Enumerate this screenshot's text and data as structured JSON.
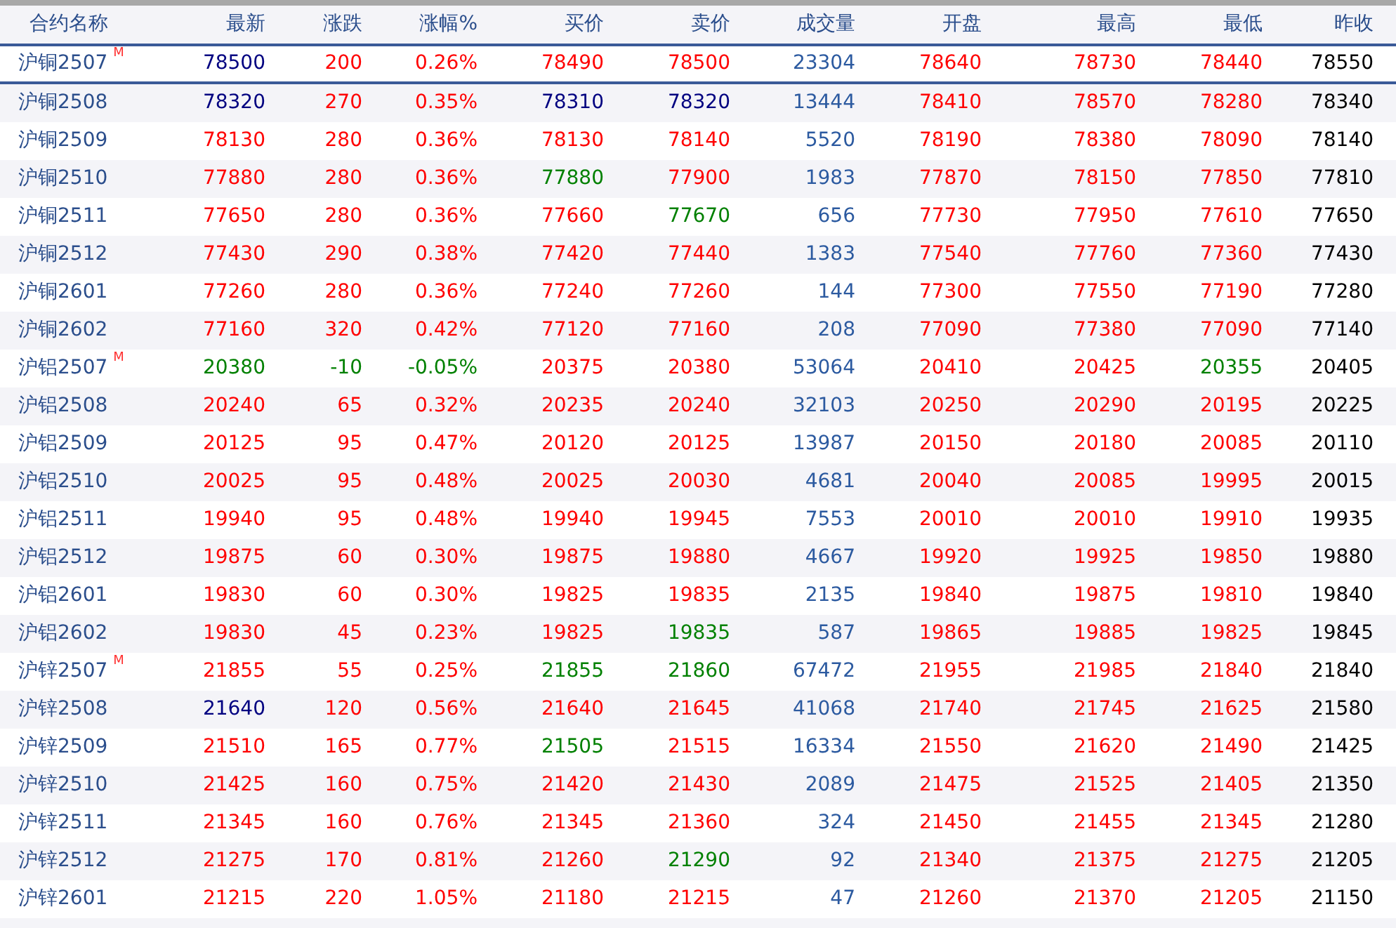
{
  "table": {
    "name_column": "合约名称",
    "columns": [
      "最新",
      "涨跌",
      "涨幅%",
      "买价",
      "卖价",
      "成交量",
      "开盘",
      "最高",
      "最低",
      "昨收"
    ],
    "rows": [
      {
        "name": "沪铜2507",
        "main_mark": "M",
        "selected": true,
        "cells": [
          {
            "text": "78500",
            "color": "#000080"
          },
          {
            "text": "200",
            "color": "#ff0000"
          },
          {
            "text": "0.26%",
            "color": "#ff0000"
          },
          {
            "text": "78490",
            "color": "#ff0000"
          },
          {
            "text": "78500",
            "color": "#ff0000"
          },
          {
            "text": "23304",
            "color": "#2c5aa0"
          },
          {
            "text": "78640",
            "color": "#ff0000"
          },
          {
            "text": "78730",
            "color": "#ff0000"
          },
          {
            "text": "78440",
            "color": "#ff0000"
          },
          {
            "text": "78550",
            "color": "#000000"
          }
        ]
      },
      {
        "name": "沪铜2508",
        "selected": false,
        "cells": [
          {
            "text": "78320",
            "color": "#000080"
          },
          {
            "text": "270",
            "color": "#ff0000"
          },
          {
            "text": "0.35%",
            "color": "#ff0000"
          },
          {
            "text": "78310",
            "color": "#000080"
          },
          {
            "text": "78320",
            "color": "#000080"
          },
          {
            "text": "13444",
            "color": "#2c5aa0"
          },
          {
            "text": "78410",
            "color": "#ff0000"
          },
          {
            "text": "78570",
            "color": "#ff0000"
          },
          {
            "text": "78280",
            "color": "#ff0000"
          },
          {
            "text": "78340",
            "color": "#000000"
          }
        ]
      },
      {
        "name": "沪铜2509",
        "selected": false,
        "cells": [
          {
            "text": "78130",
            "color": "#ff0000"
          },
          {
            "text": "280",
            "color": "#ff0000"
          },
          {
            "text": "0.36%",
            "color": "#ff0000"
          },
          {
            "text": "78130",
            "color": "#ff0000"
          },
          {
            "text": "78140",
            "color": "#ff0000"
          },
          {
            "text": "5520",
            "color": "#2c5aa0"
          },
          {
            "text": "78190",
            "color": "#ff0000"
          },
          {
            "text": "78380",
            "color": "#ff0000"
          },
          {
            "text": "78090",
            "color": "#ff0000"
          },
          {
            "text": "78140",
            "color": "#000000"
          }
        ]
      },
      {
        "name": "沪铜2510",
        "selected": false,
        "cells": [
          {
            "text": "77880",
            "color": "#ff0000"
          },
          {
            "text": "280",
            "color": "#ff0000"
          },
          {
            "text": "0.36%",
            "color": "#ff0000"
          },
          {
            "text": "77880",
            "color": "#008000"
          },
          {
            "text": "77900",
            "color": "#ff0000"
          },
          {
            "text": "1983",
            "color": "#2c5aa0"
          },
          {
            "text": "77870",
            "color": "#ff0000"
          },
          {
            "text": "78150",
            "color": "#ff0000"
          },
          {
            "text": "77850",
            "color": "#ff0000"
          },
          {
            "text": "77810",
            "color": "#000000"
          }
        ]
      },
      {
        "name": "沪铜2511",
        "selected": false,
        "cells": [
          {
            "text": "77650",
            "color": "#ff0000"
          },
          {
            "text": "280",
            "color": "#ff0000"
          },
          {
            "text": "0.36%",
            "color": "#ff0000"
          },
          {
            "text": "77660",
            "color": "#ff0000"
          },
          {
            "text": "77670",
            "color": "#008000"
          },
          {
            "text": "656",
            "color": "#2c5aa0"
          },
          {
            "text": "77730",
            "color": "#ff0000"
          },
          {
            "text": "77950",
            "color": "#ff0000"
          },
          {
            "text": "77610",
            "color": "#ff0000"
          },
          {
            "text": "77650",
            "color": "#000000"
          }
        ]
      },
      {
        "name": "沪铜2512",
        "selected": false,
        "cells": [
          {
            "text": "77430",
            "color": "#ff0000"
          },
          {
            "text": "290",
            "color": "#ff0000"
          },
          {
            "text": "0.38%",
            "color": "#ff0000"
          },
          {
            "text": "77420",
            "color": "#ff0000"
          },
          {
            "text": "77440",
            "color": "#ff0000"
          },
          {
            "text": "1383",
            "color": "#2c5aa0"
          },
          {
            "text": "77540",
            "color": "#ff0000"
          },
          {
            "text": "77760",
            "color": "#ff0000"
          },
          {
            "text": "77360",
            "color": "#ff0000"
          },
          {
            "text": "77430",
            "color": "#000000"
          }
        ]
      },
      {
        "name": "沪铜2601",
        "selected": false,
        "cells": [
          {
            "text": "77260",
            "color": "#ff0000"
          },
          {
            "text": "280",
            "color": "#ff0000"
          },
          {
            "text": "0.36%",
            "color": "#ff0000"
          },
          {
            "text": "77240",
            "color": "#ff0000"
          },
          {
            "text": "77260",
            "color": "#ff0000"
          },
          {
            "text": "144",
            "color": "#2c5aa0"
          },
          {
            "text": "77300",
            "color": "#ff0000"
          },
          {
            "text": "77550",
            "color": "#ff0000"
          },
          {
            "text": "77190",
            "color": "#ff0000"
          },
          {
            "text": "77280",
            "color": "#000000"
          }
        ]
      },
      {
        "name": "沪铜2602",
        "selected": false,
        "cells": [
          {
            "text": "77160",
            "color": "#ff0000"
          },
          {
            "text": "320",
            "color": "#ff0000"
          },
          {
            "text": "0.42%",
            "color": "#ff0000"
          },
          {
            "text": "77120",
            "color": "#ff0000"
          },
          {
            "text": "77160",
            "color": "#ff0000"
          },
          {
            "text": "208",
            "color": "#2c5aa0"
          },
          {
            "text": "77090",
            "color": "#ff0000"
          },
          {
            "text": "77380",
            "color": "#ff0000"
          },
          {
            "text": "77090",
            "color": "#ff0000"
          },
          {
            "text": "77140",
            "color": "#000000"
          }
        ]
      },
      {
        "name": "沪铝2507",
        "main_mark": "M",
        "selected": false,
        "cells": [
          {
            "text": "20380",
            "color": "#008000"
          },
          {
            "text": "-10",
            "color": "#008000"
          },
          {
            "text": "-0.05%",
            "color": "#008000"
          },
          {
            "text": "20375",
            "color": "#ff0000"
          },
          {
            "text": "20380",
            "color": "#ff0000"
          },
          {
            "text": "53064",
            "color": "#2c5aa0"
          },
          {
            "text": "20410",
            "color": "#ff0000"
          },
          {
            "text": "20425",
            "color": "#ff0000"
          },
          {
            "text": "20355",
            "color": "#008000"
          },
          {
            "text": "20405",
            "color": "#000000"
          }
        ]
      },
      {
        "name": "沪铝2508",
        "selected": false,
        "cells": [
          {
            "text": "20240",
            "color": "#ff0000"
          },
          {
            "text": "65",
            "color": "#ff0000"
          },
          {
            "text": "0.32%",
            "color": "#ff0000"
          },
          {
            "text": "20235",
            "color": "#ff0000"
          },
          {
            "text": "20240",
            "color": "#ff0000"
          },
          {
            "text": "32103",
            "color": "#2c5aa0"
          },
          {
            "text": "20250",
            "color": "#ff0000"
          },
          {
            "text": "20290",
            "color": "#ff0000"
          },
          {
            "text": "20195",
            "color": "#ff0000"
          },
          {
            "text": "20225",
            "color": "#000000"
          }
        ]
      },
      {
        "name": "沪铝2509",
        "selected": false,
        "cells": [
          {
            "text": "20125",
            "color": "#ff0000"
          },
          {
            "text": "95",
            "color": "#ff0000"
          },
          {
            "text": "0.47%",
            "color": "#ff0000"
          },
          {
            "text": "20120",
            "color": "#ff0000"
          },
          {
            "text": "20125",
            "color": "#ff0000"
          },
          {
            "text": "13987",
            "color": "#2c5aa0"
          },
          {
            "text": "20150",
            "color": "#ff0000"
          },
          {
            "text": "20180",
            "color": "#ff0000"
          },
          {
            "text": "20085",
            "color": "#ff0000"
          },
          {
            "text": "20110",
            "color": "#000000"
          }
        ]
      },
      {
        "name": "沪铝2510",
        "selected": false,
        "cells": [
          {
            "text": "20025",
            "color": "#ff0000"
          },
          {
            "text": "95",
            "color": "#ff0000"
          },
          {
            "text": "0.48%",
            "color": "#ff0000"
          },
          {
            "text": "20025",
            "color": "#ff0000"
          },
          {
            "text": "20030",
            "color": "#ff0000"
          },
          {
            "text": "4681",
            "color": "#2c5aa0"
          },
          {
            "text": "20040",
            "color": "#ff0000"
          },
          {
            "text": "20085",
            "color": "#ff0000"
          },
          {
            "text": "19995",
            "color": "#ff0000"
          },
          {
            "text": "20015",
            "color": "#000000"
          }
        ]
      },
      {
        "name": "沪铝2511",
        "selected": false,
        "cells": [
          {
            "text": "19940",
            "color": "#ff0000"
          },
          {
            "text": "95",
            "color": "#ff0000"
          },
          {
            "text": "0.48%",
            "color": "#ff0000"
          },
          {
            "text": "19940",
            "color": "#ff0000"
          },
          {
            "text": "19945",
            "color": "#ff0000"
          },
          {
            "text": "7553",
            "color": "#2c5aa0"
          },
          {
            "text": "20010",
            "color": "#ff0000"
          },
          {
            "text": "20010",
            "color": "#ff0000"
          },
          {
            "text": "19910",
            "color": "#ff0000"
          },
          {
            "text": "19935",
            "color": "#000000"
          }
        ]
      },
      {
        "name": "沪铝2512",
        "selected": false,
        "cells": [
          {
            "text": "19875",
            "color": "#ff0000"
          },
          {
            "text": "60",
            "color": "#ff0000"
          },
          {
            "text": "0.30%",
            "color": "#ff0000"
          },
          {
            "text": "19875",
            "color": "#ff0000"
          },
          {
            "text": "19880",
            "color": "#ff0000"
          },
          {
            "text": "4667",
            "color": "#2c5aa0"
          },
          {
            "text": "19920",
            "color": "#ff0000"
          },
          {
            "text": "19925",
            "color": "#ff0000"
          },
          {
            "text": "19850",
            "color": "#ff0000"
          },
          {
            "text": "19880",
            "color": "#000000"
          }
        ]
      },
      {
        "name": "沪铝2601",
        "selected": false,
        "cells": [
          {
            "text": "19830",
            "color": "#ff0000"
          },
          {
            "text": "60",
            "color": "#ff0000"
          },
          {
            "text": "0.30%",
            "color": "#ff0000"
          },
          {
            "text": "19825",
            "color": "#ff0000"
          },
          {
            "text": "19835",
            "color": "#ff0000"
          },
          {
            "text": "2135",
            "color": "#2c5aa0"
          },
          {
            "text": "19840",
            "color": "#ff0000"
          },
          {
            "text": "19875",
            "color": "#ff0000"
          },
          {
            "text": "19810",
            "color": "#ff0000"
          },
          {
            "text": "19840",
            "color": "#000000"
          }
        ]
      },
      {
        "name": "沪铝2602",
        "selected": false,
        "cells": [
          {
            "text": "19830",
            "color": "#ff0000"
          },
          {
            "text": "45",
            "color": "#ff0000"
          },
          {
            "text": "0.23%",
            "color": "#ff0000"
          },
          {
            "text": "19825",
            "color": "#ff0000"
          },
          {
            "text": "19835",
            "color": "#008000"
          },
          {
            "text": "587",
            "color": "#2c5aa0"
          },
          {
            "text": "19865",
            "color": "#ff0000"
          },
          {
            "text": "19885",
            "color": "#ff0000"
          },
          {
            "text": "19825",
            "color": "#ff0000"
          },
          {
            "text": "19845",
            "color": "#000000"
          }
        ]
      },
      {
        "name": "沪锌2507",
        "main_mark": "M",
        "selected": false,
        "cells": [
          {
            "text": "21855",
            "color": "#ff0000"
          },
          {
            "text": "55",
            "color": "#ff0000"
          },
          {
            "text": "0.25%",
            "color": "#ff0000"
          },
          {
            "text": "21855",
            "color": "#008000"
          },
          {
            "text": "21860",
            "color": "#008000"
          },
          {
            "text": "67472",
            "color": "#2c5aa0"
          },
          {
            "text": "21955",
            "color": "#ff0000"
          },
          {
            "text": "21985",
            "color": "#ff0000"
          },
          {
            "text": "21840",
            "color": "#ff0000"
          },
          {
            "text": "21840",
            "color": "#000000"
          }
        ]
      },
      {
        "name": "沪锌2508",
        "selected": false,
        "cells": [
          {
            "text": "21640",
            "color": "#000080"
          },
          {
            "text": "120",
            "color": "#ff0000"
          },
          {
            "text": "0.56%",
            "color": "#ff0000"
          },
          {
            "text": "21640",
            "color": "#ff0000"
          },
          {
            "text": "21645",
            "color": "#ff0000"
          },
          {
            "text": "41068",
            "color": "#2c5aa0"
          },
          {
            "text": "21740",
            "color": "#ff0000"
          },
          {
            "text": "21745",
            "color": "#ff0000"
          },
          {
            "text": "21625",
            "color": "#ff0000"
          },
          {
            "text": "21580",
            "color": "#000000"
          }
        ]
      },
      {
        "name": "沪锌2509",
        "selected": false,
        "cells": [
          {
            "text": "21510",
            "color": "#ff0000"
          },
          {
            "text": "165",
            "color": "#ff0000"
          },
          {
            "text": "0.77%",
            "color": "#ff0000"
          },
          {
            "text": "21505",
            "color": "#008000"
          },
          {
            "text": "21515",
            "color": "#ff0000"
          },
          {
            "text": "16334",
            "color": "#2c5aa0"
          },
          {
            "text": "21550",
            "color": "#ff0000"
          },
          {
            "text": "21620",
            "color": "#ff0000"
          },
          {
            "text": "21490",
            "color": "#ff0000"
          },
          {
            "text": "21425",
            "color": "#000000"
          }
        ]
      },
      {
        "name": "沪锌2510",
        "selected": false,
        "cells": [
          {
            "text": "21425",
            "color": "#ff0000"
          },
          {
            "text": "160",
            "color": "#ff0000"
          },
          {
            "text": "0.75%",
            "color": "#ff0000"
          },
          {
            "text": "21420",
            "color": "#ff0000"
          },
          {
            "text": "21430",
            "color": "#ff0000"
          },
          {
            "text": "2089",
            "color": "#2c5aa0"
          },
          {
            "text": "21475",
            "color": "#ff0000"
          },
          {
            "text": "21525",
            "color": "#ff0000"
          },
          {
            "text": "21405",
            "color": "#ff0000"
          },
          {
            "text": "21350",
            "color": "#000000"
          }
        ]
      },
      {
        "name": "沪锌2511",
        "selected": false,
        "cells": [
          {
            "text": "21345",
            "color": "#ff0000"
          },
          {
            "text": "160",
            "color": "#ff0000"
          },
          {
            "text": "0.76%",
            "color": "#ff0000"
          },
          {
            "text": "21345",
            "color": "#ff0000"
          },
          {
            "text": "21360",
            "color": "#ff0000"
          },
          {
            "text": "324",
            "color": "#2c5aa0"
          },
          {
            "text": "21450",
            "color": "#ff0000"
          },
          {
            "text": "21455",
            "color": "#ff0000"
          },
          {
            "text": "21345",
            "color": "#ff0000"
          },
          {
            "text": "21280",
            "color": "#000000"
          }
        ]
      },
      {
        "name": "沪锌2512",
        "selected": false,
        "cells": [
          {
            "text": "21275",
            "color": "#ff0000"
          },
          {
            "text": "170",
            "color": "#ff0000"
          },
          {
            "text": "0.81%",
            "color": "#ff0000"
          },
          {
            "text": "21260",
            "color": "#ff0000"
          },
          {
            "text": "21290",
            "color": "#008000"
          },
          {
            "text": "92",
            "color": "#2c5aa0"
          },
          {
            "text": "21340",
            "color": "#ff0000"
          },
          {
            "text": "21375",
            "color": "#ff0000"
          },
          {
            "text": "21275",
            "color": "#ff0000"
          },
          {
            "text": "21205",
            "color": "#000000"
          }
        ]
      },
      {
        "name": "沪锌2601",
        "selected": false,
        "cells": [
          {
            "text": "21215",
            "color": "#ff0000"
          },
          {
            "text": "220",
            "color": "#ff0000"
          },
          {
            "text": "1.05%",
            "color": "#ff0000"
          },
          {
            "text": "21180",
            "color": "#ff0000"
          },
          {
            "text": "21215",
            "color": "#ff0000"
          },
          {
            "text": "47",
            "color": "#2c5aa0"
          },
          {
            "text": "21260",
            "color": "#ff0000"
          },
          {
            "text": "21370",
            "color": "#ff0000"
          },
          {
            "text": "21205",
            "color": "#ff0000"
          },
          {
            "text": "21150",
            "color": "#000000"
          }
        ]
      }
    ]
  }
}
